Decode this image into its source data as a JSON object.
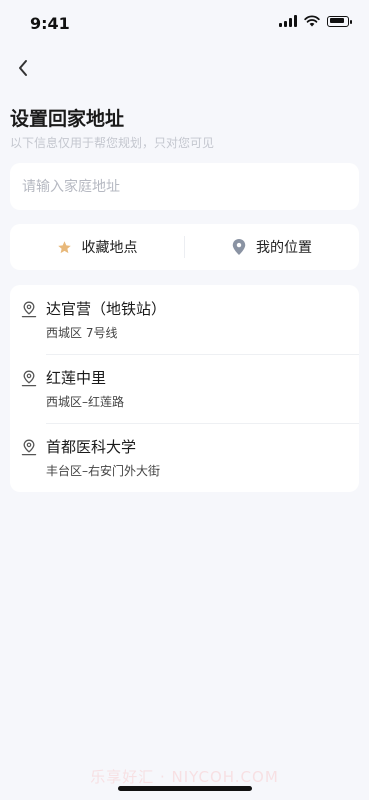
{
  "status_bar": {
    "time": "9:41"
  },
  "header": {
    "title": "设置回家地址",
    "subtitle": "以下信息仅用于帮您规划，只对您可见"
  },
  "search": {
    "placeholder": "请输入家庭地址"
  },
  "quick_actions": {
    "favorites_label": "收藏地点",
    "my_location_label": "我的位置"
  },
  "places": [
    {
      "name": "达官营（地铁站）",
      "address": "西城区 7号线"
    },
    {
      "name": "红莲中里",
      "address": "西城区–红莲路"
    },
    {
      "name": "首都医科大学",
      "address": "丰台区–右安门外大街"
    }
  ],
  "watermark": "乐享好汇 · NIYCOH.COM",
  "colors": {
    "background": "#f6f7fb",
    "star": "#e8b87a",
    "location_pin": "#8a93a3"
  },
  "icons": [
    "back-arrow-icon",
    "star-icon",
    "location-pin-icon",
    "place-pin-icon",
    "signal-icon",
    "wifi-icon",
    "battery-icon"
  ]
}
